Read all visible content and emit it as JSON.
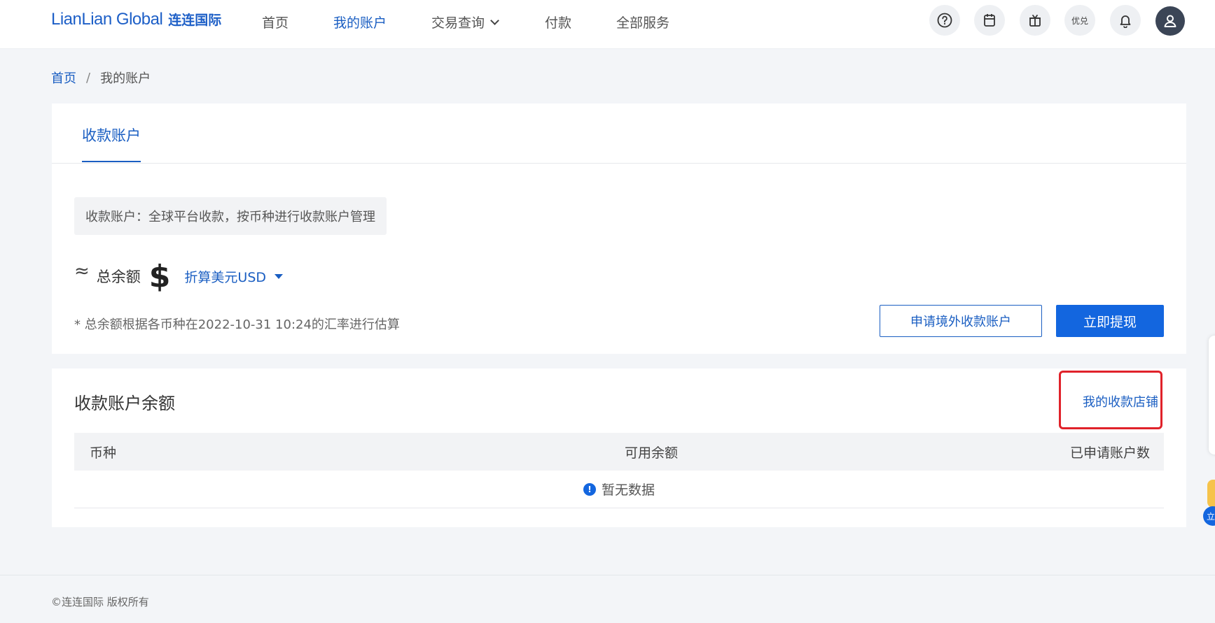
{
  "brand": {
    "logo_en": "LianLian Global",
    "logo_cn": "连连国际"
  },
  "nav": {
    "items": [
      {
        "label": "首页"
      },
      {
        "label": "我的账户"
      },
      {
        "label": "交易查询"
      },
      {
        "label": "付款"
      },
      {
        "label": "全部服务"
      }
    ],
    "active_index": 1,
    "coupon_label": "优兑",
    "icons": [
      "help-icon",
      "calendar-icon",
      "gift-icon",
      "coupon-icon",
      "bell-icon",
      "user-icon"
    ]
  },
  "breadcrumb": {
    "home": "首页",
    "separator": "/",
    "current": "我的账户"
  },
  "tabs": [
    {
      "label": "收款账户"
    }
  ],
  "info": {
    "text": "收款账户：全球平台收款，按币种进行收款账户管理"
  },
  "total": {
    "approx_symbol": "≈",
    "label": "总余额",
    "currency_symbol": "$",
    "currency_select": "折算美元USD",
    "note": "* 总余额根据各币种在2022-10-31 10:24的汇率进行估算"
  },
  "buttons": {
    "apply": "申请境外收款账户",
    "withdraw": "立即提现"
  },
  "balance_section": {
    "title": "收款账户余额",
    "store_link": "我的收款店铺",
    "columns": [
      "币种",
      "可用余额",
      "已申请账户数"
    ],
    "empty_text": "暂无数据"
  },
  "float_widget": {
    "label": "立"
  },
  "footer": {
    "copyright": "©连连国际 版权所有"
  },
  "colors": {
    "brand": "#1a5ec2",
    "primary_button": "#1366df",
    "highlight": "#e0222a"
  }
}
